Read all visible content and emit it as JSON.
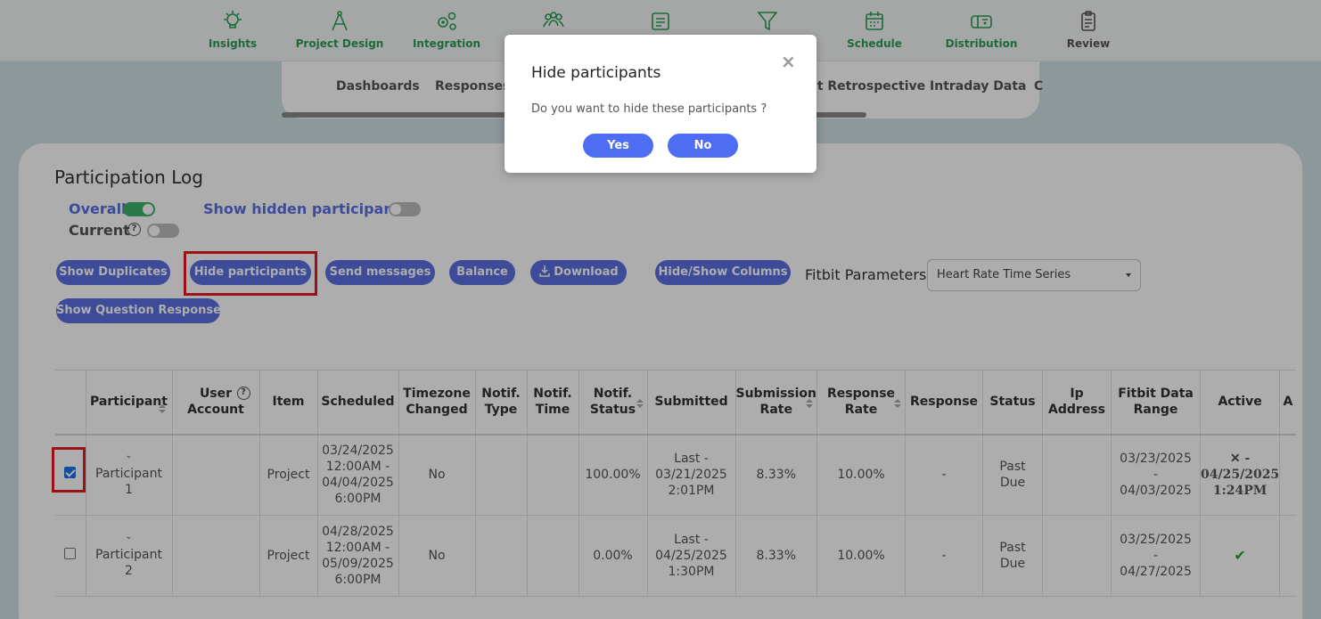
{
  "nav": [
    {
      "label": "Insights",
      "icon": "lightbulb-icon"
    },
    {
      "label": "Project Design",
      "icon": "compass-icon"
    },
    {
      "label": "Integration",
      "icon": "gears-icon"
    },
    {
      "label": "",
      "icon": "people-icon"
    },
    {
      "label": "",
      "icon": "document-icon"
    },
    {
      "label": "",
      "icon": "filter-icon"
    },
    {
      "label": "Schedule",
      "icon": "calendar-icon"
    },
    {
      "label": "Distribution",
      "icon": "mailbox-icon"
    },
    {
      "label": "Review",
      "icon": "clipboard-icon"
    }
  ],
  "subtabs": [
    "Dashboards",
    "Responses",
    "bit Retrospective Intraday Data",
    "C"
  ],
  "log": {
    "title": "Participation Log",
    "overall_label": "Overall",
    "current_label": "Current",
    "show_hidden_label": "Show hidden participants",
    "help_glyph": "?"
  },
  "buttons": {
    "show_duplicates": "Show Duplicates",
    "hide_participants": "Hide participants",
    "send_messages": "Send messages",
    "balance": "Balance",
    "download": "Download",
    "hide_show_columns": "Hide/Show Columns",
    "show_question_response": "Show Question Response"
  },
  "fitbit": {
    "label": "Fitbit Parameters",
    "selected": "Heart Rate Time Series"
  },
  "table": {
    "headers": {
      "participant": "Participant",
      "user_account_1": "User",
      "user_account_2": "Account",
      "item": "Item",
      "scheduled": "Scheduled",
      "tz_1": "Timezone",
      "tz_2": "Changed",
      "ntype_1": "Notif.",
      "ntype_2": "Type",
      "ntime_1": "Notif.",
      "ntime_2": "Time",
      "nstatus_1": "Notif.",
      "nstatus_2": "Status",
      "submitted": "Submitted",
      "subrate_1": "Submission",
      "subrate_2": "Rate",
      "resprate_1": "Response",
      "resprate_2": "Rate",
      "response": "Response",
      "status": "Status",
      "ip_1": "Ip",
      "ip_2": "Address",
      "fitbit_1": "Fitbit Data",
      "fitbit_2": "Range",
      "active": "Active",
      "extra": "A"
    },
    "rows": [
      {
        "checked": true,
        "participant_1": "Participant",
        "participant_2": "1",
        "item": "Project",
        "sched_1": "03/24/2025",
        "sched_2": "12:00AM -",
        "sched_3": "04/04/2025",
        "sched_4": "6:00PM",
        "tz": "No",
        "nstatus": "100.00%",
        "sub_1": "Last -",
        "sub_2": "03/21/2025",
        "sub_3": "2:01PM",
        "subrate": "8.33%",
        "resprate": "10.00%",
        "response": "-",
        "status_1": "Past",
        "status_2": "Due",
        "fb_1": "03/23/2025",
        "fb_2": "-",
        "fb_3": "04/03/2025",
        "active_1": "✕ -",
        "active_2": "04/25/2025",
        "active_3": "1:24PM"
      },
      {
        "checked": false,
        "participant_1": "Participant",
        "participant_2": "2",
        "item": "Project",
        "sched_1": "04/28/2025",
        "sched_2": "12:00AM -",
        "sched_3": "05/09/2025",
        "sched_4": "6:00PM",
        "tz": "No",
        "nstatus": "0.00%",
        "sub_1": "Last -",
        "sub_2": "04/25/2025",
        "sub_3": "1:30PM",
        "subrate": "8.33%",
        "resprate": "10.00%",
        "response": "-",
        "status_1": "Past",
        "status_2": "Due",
        "fb_1": "03/25/2025",
        "fb_2": "-",
        "fb_3": "04/27/2025",
        "active_mark": "✔"
      }
    ]
  },
  "modal": {
    "title": "Hide participants",
    "close": "×",
    "message": "Do you want to hide these participants ?",
    "yes": "Yes",
    "no": "No"
  },
  "colors": {
    "accent": "#5a6fe0",
    "nav_green": "#2a9d55",
    "highlight": "#e31b23"
  }
}
